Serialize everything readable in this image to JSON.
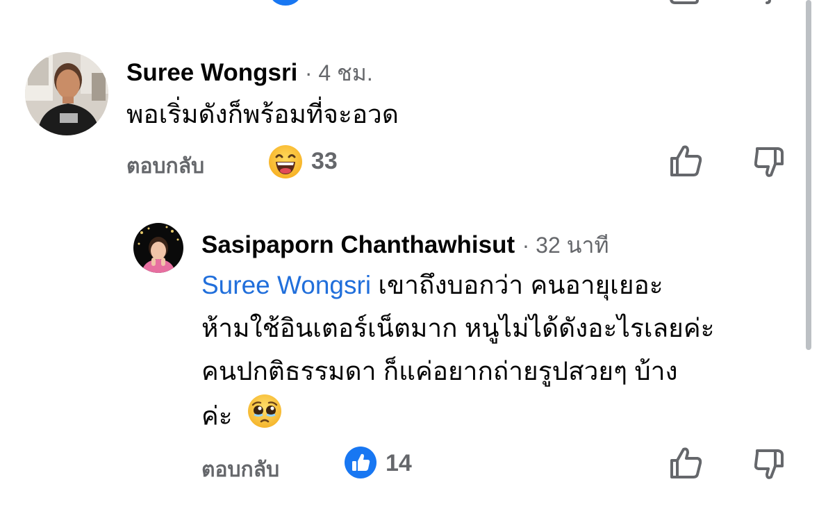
{
  "comments": [
    {
      "author": "Suree Wongsri",
      "meta": "· 4 ชม.",
      "text": "พอเริ่มดังก็พร้อมที่จะอวด",
      "reply_label": "ตอบกลับ",
      "reaction_icon": "laughing-emoji-icon",
      "reaction_count": "33"
    }
  ],
  "reply": {
    "author": "Sasipaporn Chanthawhisut",
    "meta": "· 32 นาที",
    "mention": "Suree Wongsri",
    "line1_rest": " เขาถึงบอกว่า คนอายุเยอะ",
    "line2": "ห้ามใช้อินเตอร์เน็ตมาก หนูไม่ได้ดังอะไรเลยค่ะ",
    "line3": "คนปกติธรรมดา ก็แค่อยากถ่ายรูปสวยๆ บ้าง",
    "line4": "ค่ะ",
    "inline_emoji": "pleading-face-emoji-icon",
    "reply_label": "ตอบกลับ",
    "reaction_icon": "like-reaction-icon",
    "reaction_count": "14"
  },
  "colors": {
    "accent": "#1877f2",
    "mention": "#216fdb",
    "secondary_text": "#65676b"
  }
}
